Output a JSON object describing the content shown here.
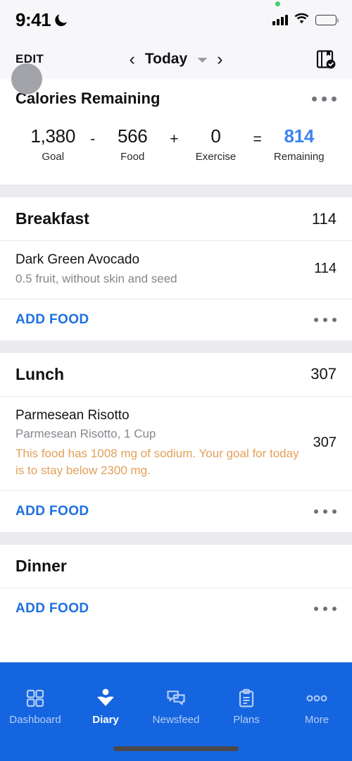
{
  "status_bar": {
    "time": "9:41",
    "dnd_icon": "moon-icon",
    "signal_icon": "cellular-signal-icon",
    "wifi_icon": "wifi-icon",
    "battery_icon": "battery-icon",
    "recording_dot_color": "#3fcf6a"
  },
  "nav_bar": {
    "edit_label": "EDIT",
    "prev_icon": "chevron-left-icon",
    "date_label": "Today",
    "dropdown_icon": "caret-down-icon",
    "next_icon": "chevron-right-icon",
    "journal_icon": "journal-check-icon"
  },
  "calories": {
    "title": "Calories Remaining",
    "menu_icon": "more-options-icon",
    "avatar_icon": "avatar-placeholder",
    "cells": [
      {
        "value": "1,380",
        "label": "Goal",
        "accent": false
      },
      {
        "value": "566",
        "label": "Food",
        "accent": false
      },
      {
        "value": "0",
        "label": "Exercise",
        "accent": false
      },
      {
        "value": "814",
        "label": "Remaining",
        "accent": true
      }
    ],
    "operators": [
      "-",
      "+",
      "="
    ],
    "accent_color": "#3d82f2"
  },
  "meals": [
    {
      "name": "Breakfast",
      "calories": "114",
      "foods": [
        {
          "title": "Dark Green Avocado",
          "subtitle": "0.5 fruit, without skin and seed",
          "warning": "",
          "calories": "114"
        }
      ],
      "add_label": "ADD FOOD",
      "menu_icon": "more-options-icon"
    },
    {
      "name": "Lunch",
      "calories": "307",
      "foods": [
        {
          "title": "Parmesean Risotto",
          "subtitle": "Parmesean Risotto, 1 Cup",
          "warning": "This food has 1008 mg of sodium. Your goal for today is to stay below 2300 mg.",
          "calories": "307"
        }
      ],
      "add_label": "ADD FOOD",
      "menu_icon": "more-options-icon"
    },
    {
      "name": "Dinner",
      "calories": "",
      "foods": [],
      "add_label": "ADD FOOD",
      "menu_icon": "more-options-icon"
    }
  ],
  "tab_bar": {
    "background_color": "#1565e0",
    "tabs": [
      {
        "label": "Dashboard",
        "icon": "grid-icon",
        "active": false
      },
      {
        "label": "Diary",
        "icon": "open-book-icon",
        "active": true
      },
      {
        "label": "Newsfeed",
        "icon": "chat-bubbles-icon",
        "active": false
      },
      {
        "label": "Plans",
        "icon": "clipboard-icon",
        "active": false
      },
      {
        "label": "More",
        "icon": "more-dots-icon",
        "active": false
      }
    ]
  }
}
